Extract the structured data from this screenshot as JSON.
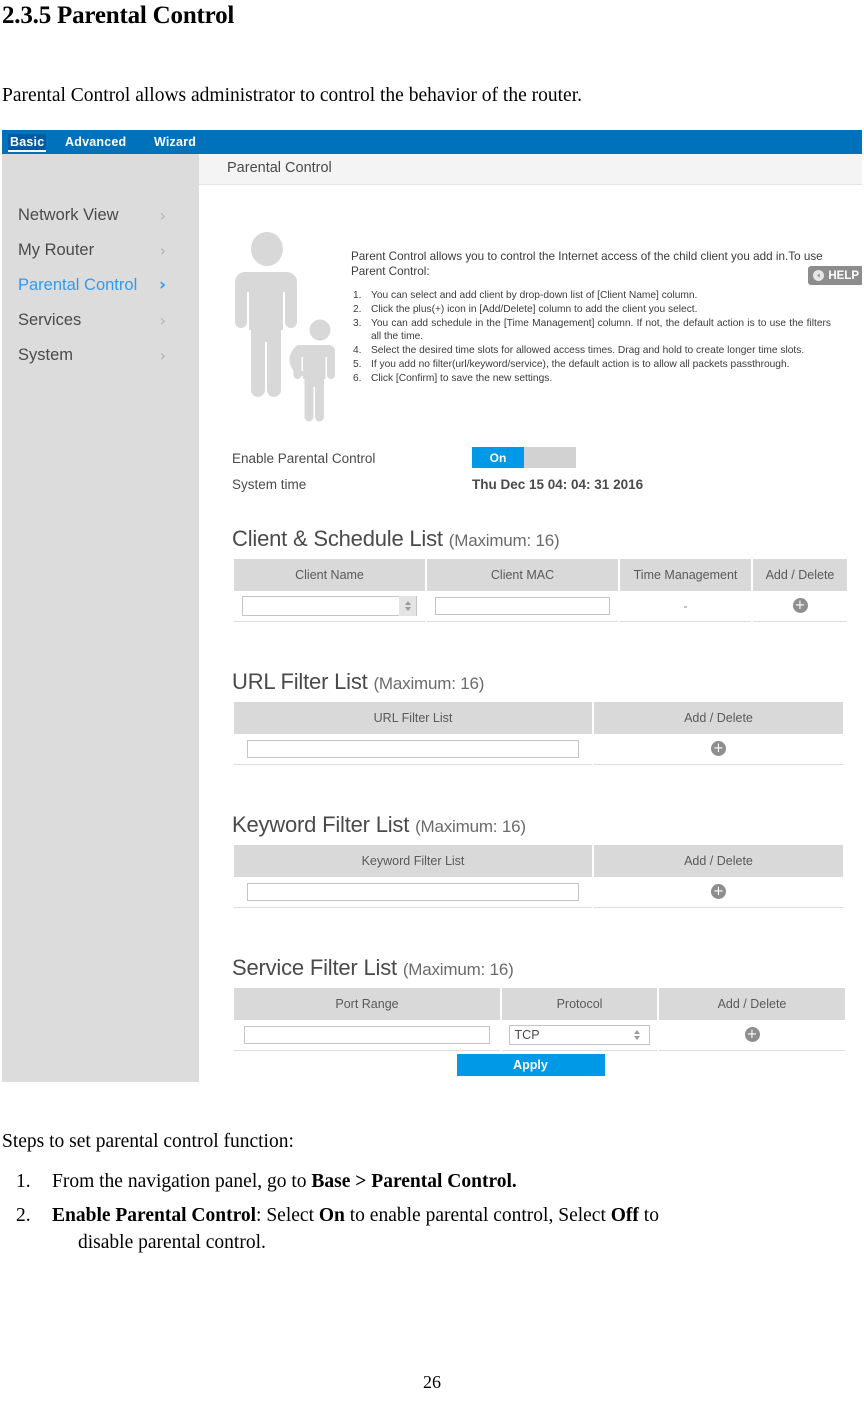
{
  "document": {
    "heading": "2.3.5 Parental Control",
    "intro": "Parental Control allows administrator to control the behavior of the router.",
    "steps_intro": "Steps to set parental control function:",
    "steps": [
      {
        "num": "1.",
        "text_plain": "From the navigation panel, go to ",
        "bold": "Base > Parental Control."
      },
      {
        "num": "2.",
        "b1": "Enable Parental Control",
        "t1": ": Select ",
        "b2": "On",
        "t2": " to enable parental control, Select ",
        "b3": "Off",
        "t3": " to",
        "cont": "disable parental control."
      }
    ],
    "page_number": "26"
  },
  "router_ui": {
    "topbar": {
      "tabs": [
        {
          "label": "Basic",
          "active": true
        },
        {
          "label": "Advanced",
          "active": false
        },
        {
          "label": "Wizard",
          "active": false
        }
      ]
    },
    "sidebar": {
      "items": [
        {
          "label": "Network View",
          "chevron": "›",
          "selected": false
        },
        {
          "label": "My Router",
          "chevron": "›",
          "selected": false
        },
        {
          "label": "Parental Control",
          "chevron": "›",
          "selected": true
        },
        {
          "label": "Services",
          "chevron": "›",
          "selected": false
        },
        {
          "label": "System",
          "chevron": "›",
          "selected": false
        }
      ]
    },
    "content_header": {
      "title": "Parental Control"
    },
    "help_button": {
      "label": "HELP",
      "icon": "chevron-left-circle-icon"
    },
    "illustration": {
      "name": "parent-and-child-silhouette"
    },
    "intro_panel": {
      "lead": "Parent Control allows you to control the Internet access of the child client you add in.To use Parent Control:",
      "items": [
        {
          "n": "1.",
          "text": "You can select and add client by drop-down list of [Client Name] column."
        },
        {
          "n": "2.",
          "text": "Click the plus(+) icon in [Add/Delete] column to add the client you select."
        },
        {
          "n": "3.",
          "text": "You can add schedule in the [Time Management] column. If not, the default action is to use the filters all the time."
        },
        {
          "n": "4.",
          "text": "Select the desired time slots for allowed access times. Drag and hold to create longer time slots."
        },
        {
          "n": "5.",
          "text": "If you add no filter(url/keyword/service), the default action is to allow all packets passthrough."
        },
        {
          "n": "6.",
          "text": "Click [Confirm] to save the new settings."
        }
      ]
    },
    "settings": {
      "enable_label": "Enable Parental Control",
      "toggle_on_label": "On",
      "toggle_state": "On",
      "systime_label": "System time",
      "systime_value": "Thu Dec 15 04: 04: 31 2016"
    },
    "sections": {
      "client": {
        "title": "Client & Schedule List",
        "max": "(Maximum: 16)",
        "headers": [
          "Client Name",
          "Client MAC",
          "Time Management",
          "Add / Delete"
        ],
        "row": {
          "client_name_value": "",
          "client_mac_value": "",
          "time_management_value": "-",
          "add_icon": "plus-icon"
        }
      },
      "url": {
        "title": "URL Filter List",
        "max": "(Maximum: 16)",
        "headers": [
          "URL Filter List",
          "Add / Delete"
        ],
        "row": {
          "value": "",
          "add_icon": "plus-icon"
        }
      },
      "keyword": {
        "title": "Keyword Filter List",
        "max": "(Maximum: 16)",
        "headers": [
          "Keyword Filter List",
          "Add / Delete"
        ],
        "row": {
          "value": "",
          "add_icon": "plus-icon"
        }
      },
      "service": {
        "title": "Service Filter List",
        "max": "(Maximum: 16)",
        "headers": [
          "Port Range",
          "Protocol",
          "Add / Delete"
        ],
        "row": {
          "port_range_value": "",
          "protocol_value": "TCP",
          "add_icon": "plus-icon"
        }
      }
    },
    "apply_button": {
      "label": "Apply"
    },
    "colors": {
      "topbar_blue": "#0072bc",
      "accent_blue": "#0099e8",
      "selected_nav_blue": "#2f9bf0",
      "sidebar_gray": "#dcdcdc",
      "table_header_gray": "#d9d9d9"
    }
  }
}
